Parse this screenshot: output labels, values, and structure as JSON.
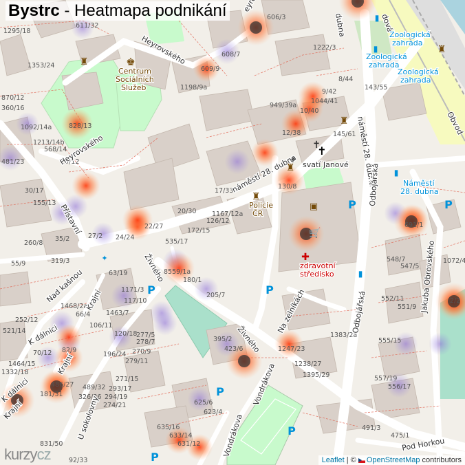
{
  "title": {
    "bold": "Bystrc",
    "rest": " - Heatmapa podnikání"
  },
  "logo": {
    "main": "kurzy",
    "suffix": "cz"
  },
  "attribution": {
    "leaflet": "Leaflet",
    "sep": " | © ",
    "osm": "OpenStreetMap",
    "contrib": " contributors"
  },
  "colors": {
    "land": "#f2efe9",
    "building": "#d9d0c9",
    "park": "#c8facc",
    "pitch": "#aae0cb",
    "tram": "#f7fabf",
    "road": "#ffffff",
    "parcel": "#e0604d",
    "poi": "#734a08",
    "transit": "#0092da",
    "parking": "#0092da"
  },
  "streets": [
    {
      "label": "Heyrovského"
    },
    {
      "label": "Heyrovského"
    },
    {
      "label": "náměstí 28. dubna"
    },
    {
      "label": "náměstí 28. dubna"
    },
    {
      "label": "Přístavní"
    },
    {
      "label": "Nad kašnou"
    },
    {
      "label": "Krajní"
    },
    {
      "label": "Krajní"
    },
    {
      "label": "Krajní"
    },
    {
      "label": "K dálnici"
    },
    {
      "label": "K dálnici"
    },
    {
      "label": "U sokolovny"
    },
    {
      "label": "Živného"
    },
    {
      "label": "Živného"
    },
    {
      "label": "Na zelníkách"
    },
    {
      "label": "Odbojářská"
    },
    {
      "label": "Odbojářská"
    },
    {
      "label": "Jakuba Obrovského"
    },
    {
      "label": "Vondrákova"
    },
    {
      "label": "Vondrákova"
    },
    {
      "label": "Pod Horkou"
    },
    {
      "label": "Obvod"
    },
    {
      "label": "dová"
    },
    {
      "label": "eyro"
    },
    {
      "label": "dubna"
    }
  ],
  "places": [
    {
      "label": "Centrum",
      "icon": "community-icon"
    },
    {
      "label": "Sociálních",
      "icon": ""
    },
    {
      "label": "Služeb",
      "icon": ""
    },
    {
      "label": "svatí Janové",
      "icon": "church-icon"
    },
    {
      "label": "Policie",
      "icon": "police-icon"
    },
    {
      "label": "ČR",
      "icon": ""
    },
    {
      "label": "zdravotní",
      "icon": "health-icon"
    },
    {
      "label": "středisko",
      "icon": ""
    },
    {
      "label": "Zoologická",
      "icon": ""
    },
    {
      "label": "zahrada",
      "icon": ""
    },
    {
      "label": "Zoologická",
      "icon": ""
    },
    {
      "label": "zahrada",
      "icon": ""
    },
    {
      "label": "Zoologická",
      "icon": ""
    },
    {
      "label": "zahrada",
      "icon": ""
    },
    {
      "label": "Náměstí",
      "icon": ""
    },
    {
      "label": "28. dubna",
      "icon": ""
    }
  ],
  "house_numbers": [
    "1295/18",
    "611/32",
    "606/3",
    "1222/3",
    "608/7",
    "609/9",
    "1198/9a",
    "1353/24",
    "870/12",
    "360/16",
    "1092/14a",
    "828/13",
    "1213/14b",
    "568/14",
    "29/12",
    "481/23",
    "30/17",
    "155/13",
    "35/2",
    "260/8",
    "27/2",
    "24/24",
    "22/27",
    "20/30",
    "17/33",
    "1167/12a",
    "126/12",
    "172/15",
    "535/17",
    "130/8",
    "12/38",
    "1044/41",
    "10/40",
    "9/42",
    "8/44",
    "143/55",
    "949/39a",
    "145/61",
    "319/3",
    "55/9",
    "63/19",
    "8559/1a",
    "180/1",
    "1171/3",
    "117/10",
    "205/7",
    "1468/2a",
    "66/4",
    "1463/7",
    "252/12",
    "521/14",
    "106/11",
    "120/18",
    "277/5",
    "278/7",
    "70/12",
    "82/9",
    "196/24",
    "270/9",
    "279/11",
    "1464/15",
    "1332/18",
    "486/27",
    "181/31",
    "489/32",
    "293/17",
    "326/36",
    "294/19",
    "274/21",
    "271/15",
    "395/2",
    "423/6",
    "1247/23",
    "1238/27",
    "1395/29",
    "1383/2a",
    "625/6",
    "623/4",
    "635/16",
    "633/14",
    "631/12",
    "831/50",
    "92/33",
    "691/1",
    "548/7",
    "547/5",
    "1072/4",
    "552/11",
    "551/9",
    "2/2",
    "555/15",
    "557/19",
    "556/17",
    "491/3",
    "475/1"
  ],
  "map_icons": [
    {
      "icon": "cross-icon"
    },
    {
      "icon": "cross-icon"
    },
    {
      "icon": "monument-icon"
    },
    {
      "icon": "monument-icon"
    },
    {
      "icon": "monument-icon"
    },
    {
      "icon": "museum-icon"
    },
    {
      "icon": "cinema-icon"
    },
    {
      "icon": "shopping-cart-icon"
    },
    {
      "icon": "bus-stop-icon"
    },
    {
      "icon": "bus-stop-icon"
    },
    {
      "icon": "bus-stop-icon"
    },
    {
      "icon": "bus-stop-icon"
    },
    {
      "icon": "parking-icon"
    },
    {
      "icon": "parking-icon"
    },
    {
      "icon": "parking-icon"
    },
    {
      "icon": "parking-icon"
    },
    {
      "icon": "parking-icon"
    },
    {
      "icon": "parking-icon"
    },
    {
      "icon": "parking-icon"
    },
    {
      "icon": "fountain-icon"
    }
  ],
  "heatmap_points": [
    {
      "v": 0.3
    },
    {
      "v": 0.95
    },
    {
      "v": 0.9
    },
    {
      "v": 0.45
    },
    {
      "v": 0.4
    },
    {
      "v": 0.5
    },
    {
      "v": 0.6
    },
    {
      "v": 0.7
    },
    {
      "v": 0.3
    },
    {
      "v": 0.4
    },
    {
      "v": 0.35
    },
    {
      "v": 0.55
    },
    {
      "v": 0.35
    },
    {
      "v": 0.3
    },
    {
      "v": 0.45
    },
    {
      "v": 0.65
    },
    {
      "v": 0.4
    },
    {
      "v": 0.7
    },
    {
      "v": 0.35
    },
    {
      "v": 0.4
    },
    {
      "v": 0.35
    },
    {
      "v": 0.35
    },
    {
      "v": 0.3
    },
    {
      "v": 0.4
    },
    {
      "v": 0.3
    },
    {
      "v": 0.3
    },
    {
      "v": 0.45
    },
    {
      "v": 0.55
    },
    {
      "v": 0.55
    },
    {
      "v": 0.85
    },
    {
      "v": 0.8
    },
    {
      "v": 0.9
    },
    {
      "v": 0.6
    },
    {
      "v": 0.3
    },
    {
      "v": 0.55
    },
    {
      "v": 0.85
    },
    {
      "v": 0.3
    },
    {
      "v": 0.95
    },
    {
      "v": 0.4
    },
    {
      "v": 0.35
    },
    {
      "v": 0.55
    },
    {
      "v": 0.9
    },
    {
      "v": 0.4
    },
    {
      "v": 0.35
    },
    {
      "v": 0.5
    },
    {
      "v": 0.45
    },
    {
      "v": 0.6
    },
    {
      "v": 0.4
    },
    {
      "v": 0.5
    },
    {
      "v": 0.6
    }
  ]
}
